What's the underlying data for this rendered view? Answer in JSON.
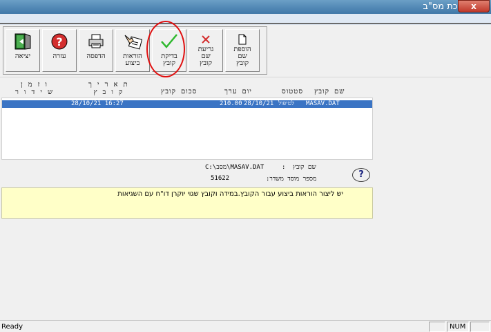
{
  "window": {
    "title": "מערכת מס\"ב",
    "close_label": "x"
  },
  "toolbar": {
    "buttons": [
      {
        "id": "exit",
        "label": "יציאה",
        "icon": "exit-door-icon"
      },
      {
        "id": "help",
        "label": "עזרה",
        "icon": "help-question-icon"
      },
      {
        "id": "print",
        "label": "הדפסה",
        "icon": "printer-icon"
      },
      {
        "id": "instructions",
        "label": "הוראות\nביצוע",
        "icon": "instructions-hand-icon"
      },
      {
        "id": "check-file",
        "label": "בדיקת\nקובץ",
        "icon": "checkmark-icon"
      },
      {
        "id": "remove-file",
        "label": "גריעת\nשם\nקובץ",
        "icon": "x-icon"
      },
      {
        "id": "add-file",
        "label": "הוספת\nשם\nקובץ",
        "icon": "new-file-icon"
      }
    ]
  },
  "list": {
    "headers": {
      "filename": "שם קובץ",
      "status": "סטטוס",
      "value_date": "יום ערך",
      "total": "סכום קובץ",
      "file_date": "ת א ר י ך\nק ו ב ץ",
      "send_date": "ו ז מ ן\nש י ד ו ר"
    },
    "rows": [
      {
        "filename": "MASAV.DAT",
        "status": "לטיפול",
        "value_date": "28/10/21",
        "total": "210.00",
        "file_date": "28/10/21 16:27",
        "send_date": ""
      }
    ]
  },
  "info": {
    "filename_label": "שם קובץ  :",
    "filename_value": "C:\\מסב\\MASAV.DAT",
    "institution_label": "מספר מוסד משדר:",
    "institution_value": "51622"
  },
  "message": {
    "text": "יש ליצור הוראות ביצוע עבור הקובץ.במידה וקובץ שגוי יוקרן דו\"ח עם השגיאות"
  },
  "status": {
    "ready": "Ready",
    "num": "NUM"
  },
  "colors": {
    "selection": "#3a74c4",
    "message_bg": "#ffffc8",
    "highlight_circle": "#e01010"
  }
}
